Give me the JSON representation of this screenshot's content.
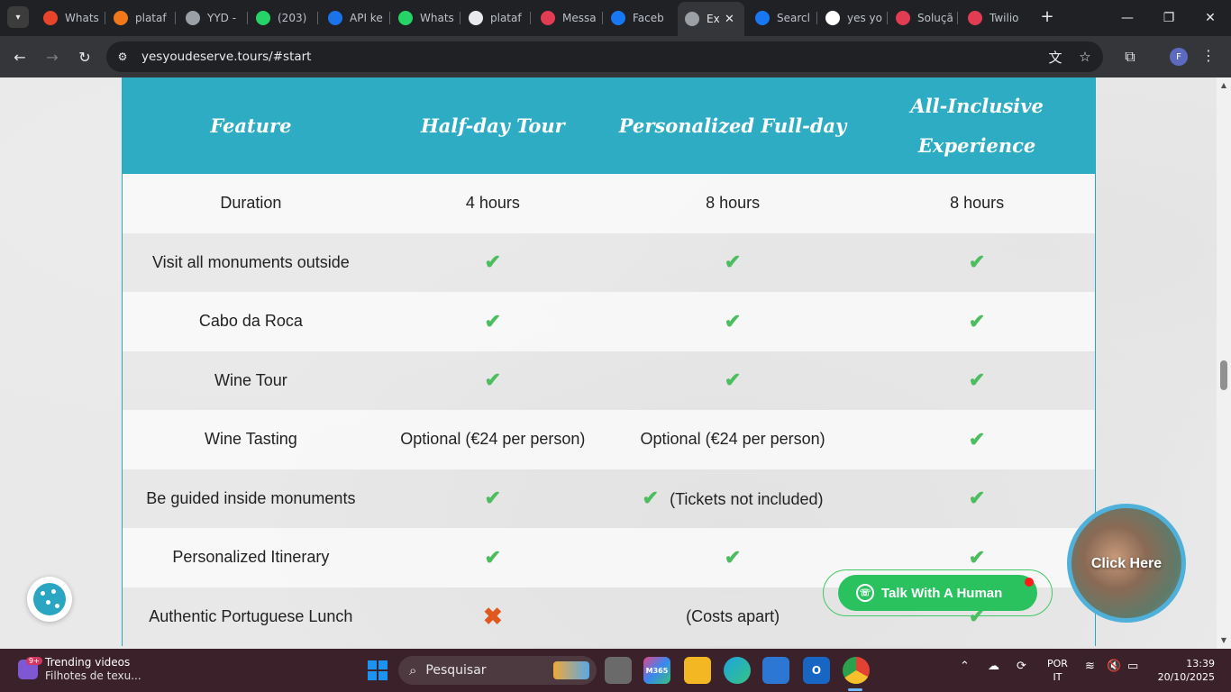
{
  "browser": {
    "tabs": [
      {
        "title": "Whats",
        "icon": "alert-icon",
        "color": "#e8442b"
      },
      {
        "title": "plataf",
        "icon": "node-icon",
        "color": "#f0781a"
      },
      {
        "title": "YYD -",
        "icon": "globe-icon",
        "color": "#9aa0a6"
      },
      {
        "title": "(203)",
        "icon": "whatsapp-icon",
        "color": "#25d366"
      },
      {
        "title": "API ke",
        "icon": "openai-icon",
        "color": "#1a73e8"
      },
      {
        "title": "Whats",
        "icon": "whatsapp-icon",
        "color": "#25d366"
      },
      {
        "title": "plataf",
        "icon": "github-icon",
        "color": "#e8eaed"
      },
      {
        "title": "Messa",
        "icon": "twilio-icon",
        "color": "#e13c52"
      },
      {
        "title": "Faceb",
        "icon": "facebook-icon",
        "color": "#1877f2"
      },
      {
        "title": "Ex",
        "icon": "site-icon",
        "color": "#9aa0a6",
        "active": true
      },
      {
        "title": "Searcl",
        "icon": "facebook-icon",
        "color": "#1877f2"
      },
      {
        "title": "yes yo",
        "icon": "google-icon",
        "color": "#ffffff"
      },
      {
        "title": "Soluçã",
        "icon": "twilio-icon",
        "color": "#e13c52"
      },
      {
        "title": "Twilio",
        "icon": "twilio-icon",
        "color": "#e13c52"
      }
    ],
    "url": "yesyoudeserve.tours/#start",
    "profile_initial": "F"
  },
  "comparison_table": {
    "headers": [
      "Feature",
      "Half-day Tour",
      "Personalized Full-day",
      "All-Inclusive Experience"
    ],
    "rows": [
      {
        "feature": "Duration",
        "half": {
          "text": "4 hours"
        },
        "full": {
          "text": "8 hours"
        },
        "all": {
          "text": "8 hours"
        }
      },
      {
        "feature": "Visit all monuments outside",
        "half": {
          "mark": "check"
        },
        "full": {
          "mark": "check"
        },
        "all": {
          "mark": "check"
        }
      },
      {
        "feature": "Cabo da Roca",
        "half": {
          "mark": "check"
        },
        "full": {
          "mark": "check"
        },
        "all": {
          "mark": "check"
        }
      },
      {
        "feature": "Wine Tour",
        "half": {
          "mark": "check"
        },
        "full": {
          "mark": "check"
        },
        "all": {
          "mark": "check"
        }
      },
      {
        "feature": "Wine Tasting",
        "half": {
          "text": "Optional (€24 per person)"
        },
        "full": {
          "text": "Optional (€24 per person)"
        },
        "all": {
          "mark": "check"
        }
      },
      {
        "feature": "Be guided inside monuments",
        "half": {
          "mark": "check"
        },
        "full": {
          "mark": "check",
          "text": "(Tickets not included)"
        },
        "all": {
          "mark": "check"
        }
      },
      {
        "feature": "Personalized Itinerary",
        "half": {
          "mark": "check"
        },
        "full": {
          "mark": "check"
        },
        "all": {
          "mark": "check"
        }
      },
      {
        "feature": "Authentic Portuguese Lunch",
        "half": {
          "mark": "cross"
        },
        "full": {
          "text": "(Costs apart)"
        },
        "all": {
          "mark": "check"
        }
      }
    ]
  },
  "widgets": {
    "whatsapp_label": "Talk With A Human",
    "video_label": "Click Here"
  },
  "taskbar": {
    "widget_badge": "9+",
    "widget_title": "Trending videos",
    "widget_subtitle": "Filhotes de texu...",
    "search_placeholder": "Pesquisar",
    "app_label_m365": "M365",
    "lang_line1": "POR",
    "lang_line2": "IT",
    "time": "13:39",
    "date": "20/10/2025"
  }
}
